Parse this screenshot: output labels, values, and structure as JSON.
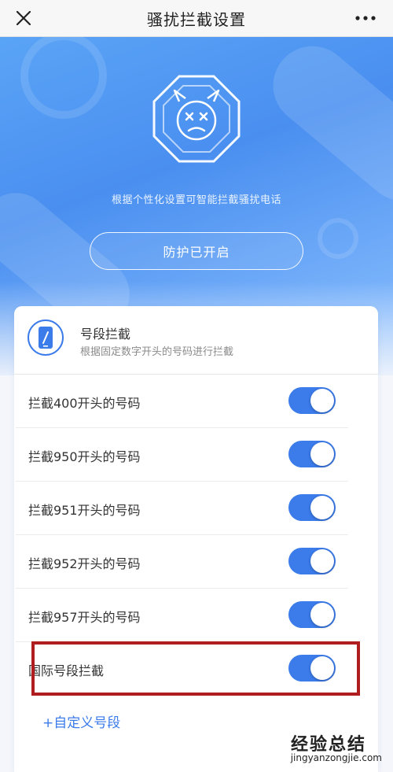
{
  "topbar": {
    "title": "骚扰拦截设置"
  },
  "hero": {
    "description": "根据个性化设置可智能拦截骚扰电话",
    "protect_button": "防护已开启"
  },
  "card": {
    "header_title": "号段拦截",
    "header_subtitle": "根据固定数字开头的号码进行拦截",
    "rows": [
      {
        "label": "拦截400开头的号码",
        "enabled": true
      },
      {
        "label": "拦截950开头的号码",
        "enabled": true
      },
      {
        "label": "拦截951开头的号码",
        "enabled": true
      },
      {
        "label": "拦截952开头的号码",
        "enabled": true
      },
      {
        "label": "拦截957开头的号码",
        "enabled": true
      },
      {
        "label": "国际号段拦截",
        "enabled": true
      }
    ],
    "add_link": "+自定义号段"
  },
  "watermark": {
    "main": "经验总结",
    "sub": "jingyanzongjie.com"
  },
  "colors": {
    "accent": "#3b7bea",
    "highlight": "#b01d1f",
    "hero_top": "#5aa4f6"
  }
}
